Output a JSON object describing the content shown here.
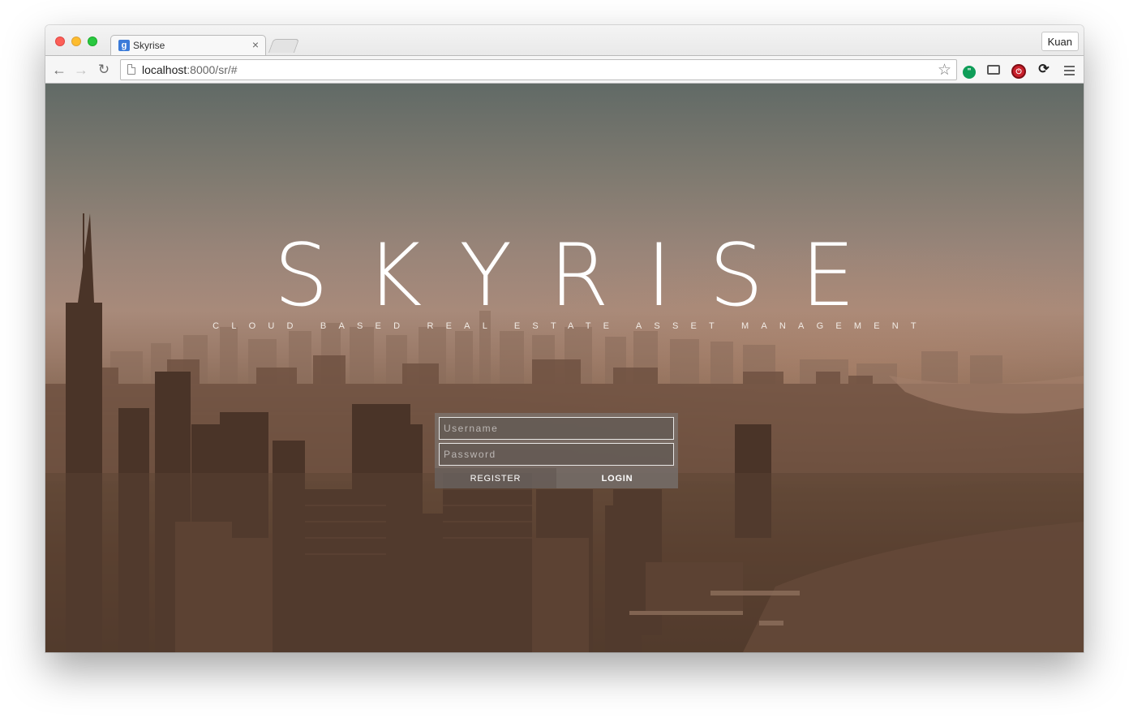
{
  "browser": {
    "tab": {
      "favicon": "g",
      "title": "Skyrise",
      "close": "×"
    },
    "profile": "Kuan",
    "nav": {
      "back": "←",
      "forward": "→",
      "reload": "↻"
    },
    "url": {
      "host": "localhost",
      "rest": ":8000/sr/#"
    },
    "icons": {
      "star": "☆",
      "hangouts": "\"",
      "block": "⏻",
      "sync": "⟳"
    }
  },
  "page": {
    "brand": "SKYRISE",
    "tagline": "CLOUD BASED REAL ESTATE ASSET MANAGEMENT",
    "login": {
      "username_placeholder": "Username",
      "password_placeholder": "Password",
      "register_label": "REGISTER",
      "login_label": "LOGIN"
    }
  },
  "colors": {
    "close": "#fc5f57",
    "minimize": "#fdbc2e",
    "maximize": "#29c840",
    "hangouts": "#0f9d58",
    "adblock": "#c9202b"
  }
}
